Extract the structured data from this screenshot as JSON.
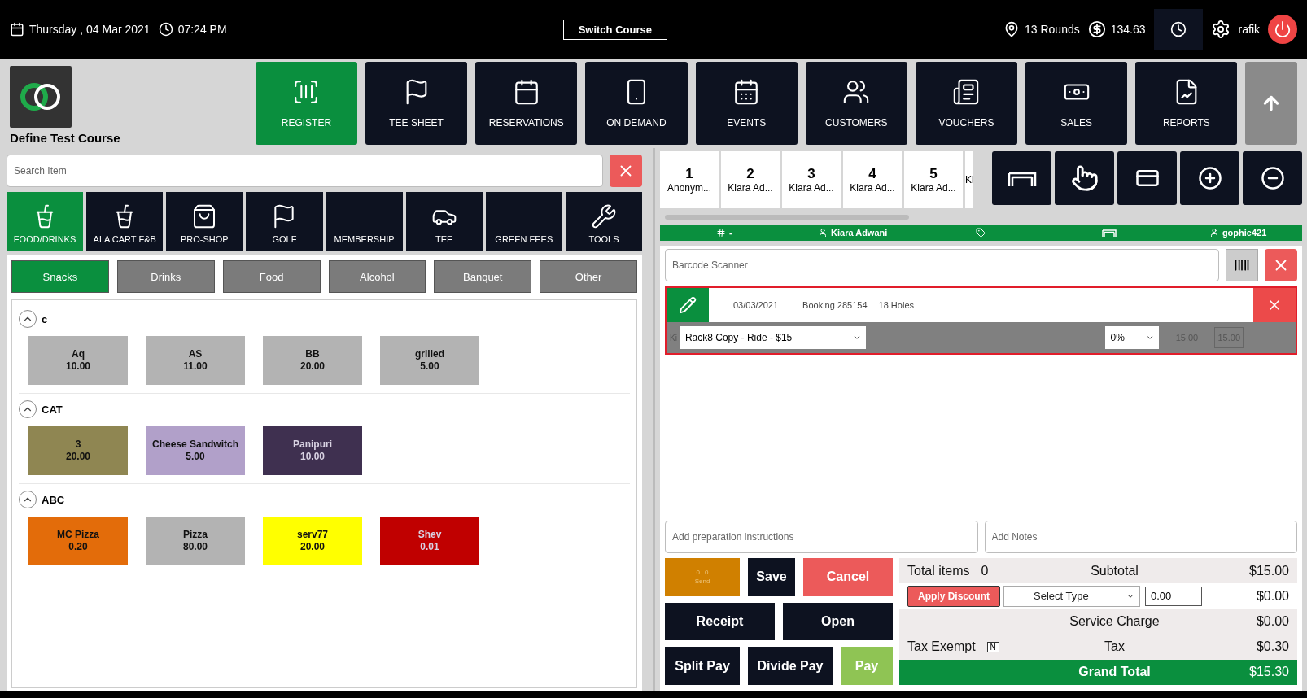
{
  "header": {
    "date": "Thursday , 04 Mar 2021",
    "time": "07:24 PM",
    "switch_course": "Switch Course",
    "rounds": "13 Rounds",
    "balance": "134.63",
    "user": "rafik"
  },
  "course": {
    "name": "Define Test Course"
  },
  "nav": [
    {
      "label": "REGISTER",
      "selected": true
    },
    {
      "label": "TEE SHEET",
      "selected": false
    },
    {
      "label": "RESERVATIONS",
      "selected": false
    },
    {
      "label": "ON DEMAND",
      "selected": false
    },
    {
      "label": "EVENTS",
      "selected": false
    },
    {
      "label": "CUSTOMERS",
      "selected": false
    },
    {
      "label": "VOUCHERS",
      "selected": false
    },
    {
      "label": "SALES",
      "selected": false
    },
    {
      "label": "REPORTS",
      "selected": false
    }
  ],
  "search": {
    "placeholder": "Search Item"
  },
  "categories": [
    {
      "label": "FOOD/DRINKS",
      "selected": true
    },
    {
      "label": "ALA CART F&B",
      "selected": false
    },
    {
      "label": "PRO-SHOP",
      "selected": false
    },
    {
      "label": "GOLF",
      "selected": false
    },
    {
      "label": "MEMBERSHIP",
      "selected": false
    },
    {
      "label": "TEE",
      "selected": false
    },
    {
      "label": "GREEN FEES",
      "selected": false
    },
    {
      "label": "TOOLS",
      "selected": false
    }
  ],
  "subcategories": [
    {
      "label": "Snacks",
      "selected": true
    },
    {
      "label": "Drinks",
      "selected": false
    },
    {
      "label": "Food",
      "selected": false
    },
    {
      "label": "Alcohol",
      "selected": false
    },
    {
      "label": "Banquet",
      "selected": false
    },
    {
      "label": "Other",
      "selected": false
    }
  ],
  "groups": [
    {
      "name": "c",
      "expanded": true,
      "items": [
        {
          "name": "Aq",
          "price": "10.00",
          "color": "#b3b3b3"
        },
        {
          "name": "AS",
          "price": "11.00",
          "color": "#b3b3b3"
        },
        {
          "name": "BB",
          "price": "20.00",
          "color": "#b3b3b3"
        },
        {
          "name": "grilled",
          "price": "5.00",
          "color": "#b3b3b3"
        }
      ]
    },
    {
      "name": "CAT",
      "expanded": true,
      "items": [
        {
          "name": "3",
          "price": "20.00",
          "color": "#8f8652"
        },
        {
          "name": "Cheese Sandwitch",
          "price": "5.00",
          "color": "#b1a0c9"
        },
        {
          "name": "Panipuri",
          "price": "10.00",
          "color": "#3f3050"
        }
      ]
    },
    {
      "name": "ABC",
      "expanded": true,
      "items": [
        {
          "name": "MC Pizza",
          "price": "0.20",
          "color": "#e36c0a"
        },
        {
          "name": "Pizza",
          "price": "80.00",
          "color": "#b3b3b3"
        },
        {
          "name": "serv77",
          "price": "20.00",
          "color": "#ffff00"
        },
        {
          "name": "Shev",
          "price": "0.01",
          "color": "#c00000"
        }
      ]
    }
  ],
  "players": [
    {
      "number": "1",
      "name": "Anonym..."
    },
    {
      "number": "2",
      "name": "Kiara  Ad..."
    },
    {
      "number": "3",
      "name": "Kiara  Ad..."
    },
    {
      "number": "4",
      "name": "Kiara  Ad..."
    },
    {
      "number": "5",
      "name": "Kiara  Ad..."
    },
    {
      "name": "Ki"
    }
  ],
  "info_bar": {
    "hash": "-",
    "customer": "Kiara  Adwani",
    "user": "gophie421"
  },
  "barcode": {
    "placeholder": "Barcode Scanner"
  },
  "booking": {
    "date": "03/03/2021",
    "booking": "Booking 285154",
    "holes": "18 Holes",
    "prefix": "Ki",
    "rate": "Rack8 Copy - Ride - $15",
    "discount": "0%",
    "price": "15.00",
    "total": "15.00"
  },
  "notes": {
    "prep_placeholder": "Add preparation instructions",
    "notes_placeholder": "Add Notes"
  },
  "send": {
    "label": "Send",
    "count_1": "0",
    "count_2": "0"
  },
  "actions": {
    "save": "Save",
    "cancel": "Cancel",
    "receipt": "Receipt",
    "open": "Open",
    "split_pay": "Split Pay",
    "divide_pay": "Divide Pay",
    "pay": "Pay"
  },
  "totals": {
    "items_label": "Total items",
    "items": "0",
    "subtotal_label": "Subtotal",
    "subtotal": "$15.00",
    "apply_discount": "Apply Discount",
    "discount_type": "Select Type",
    "discount_value": "0.00",
    "discount": "$0.00",
    "service_label": "Service Charge",
    "service": "$0.00",
    "tax_exempt_label": "Tax Exempt",
    "tax_exempt": "N",
    "tax_label": "Tax",
    "tax": "$0.30",
    "grand_label": "Grand Total",
    "grand": "$15.30"
  }
}
